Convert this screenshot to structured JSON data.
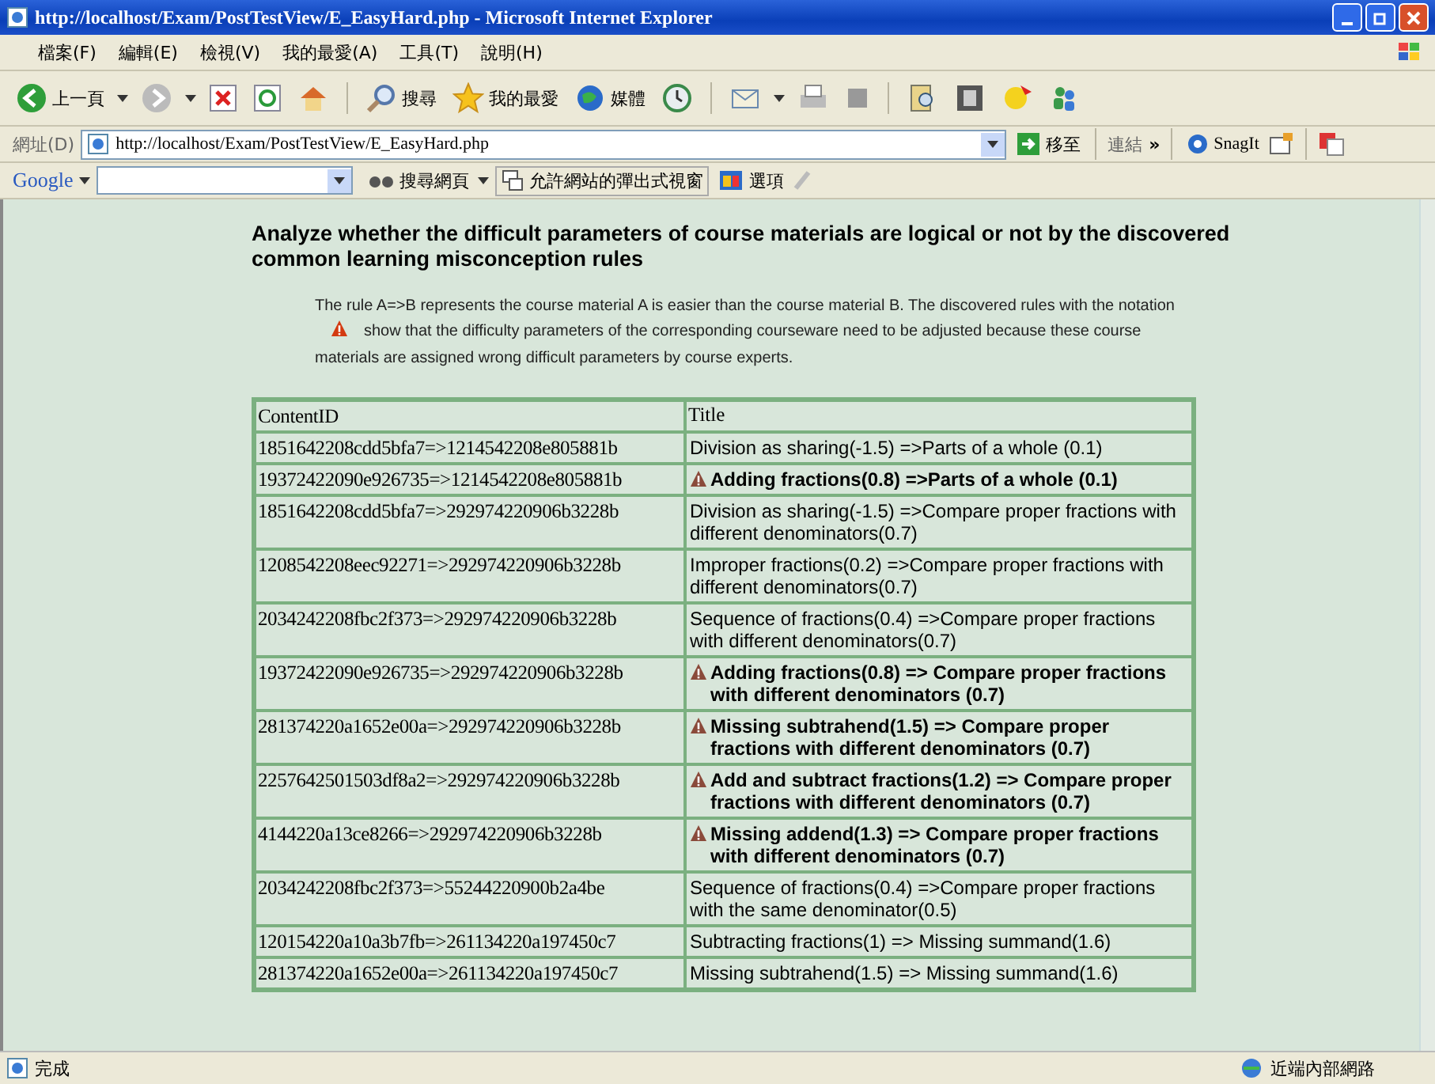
{
  "window": {
    "title": "http://localhost/Exam/PostTestView/E_EasyHard.php - Microsoft Internet Explorer"
  },
  "menu": [
    "檔案(F)",
    "編輯(E)",
    "檢視(V)",
    "我的最愛(A)",
    "工具(T)",
    "說明(H)"
  ],
  "toolbar": {
    "back": "上一頁",
    "search": "搜尋",
    "favorites": "我的最愛",
    "media": "媒體"
  },
  "address_bar": {
    "label": "網址(D)",
    "value": "http://localhost/Exam/PostTestView/E_EasyHard.php",
    "go": "移至",
    "links": "連結",
    "more": "»",
    "snagit": "SnagIt"
  },
  "google_bar": {
    "logo": "Google",
    "search_web": "搜尋網頁",
    "popups": "允許網站的彈出式視窗",
    "options": "選項"
  },
  "heading": "Analyze whether the difficult parameters of course materials are logical or not by the discovered common learning misconception rules",
  "intro_before": "The rule A=>B represents the course material A is easier than the course material B. The discovered rules with the notation",
  "intro_after": "show that the difficulty parameters of the corresponding courseware need to be adjusted because these course materials are assigned wrong difficult parameters by course experts.",
  "table": {
    "columns": [
      "ContentID",
      "Title"
    ],
    "rows": [
      {
        "id": "1851642208cdd5bfa7=>1214542208e805881b",
        "title": "Division as sharing(-1.5) =>Parts of a whole (0.1)",
        "flagged": false
      },
      {
        "id": "19372422090e926735=>1214542208e805881b",
        "title": "Adding fractions(0.8) =>Parts of a whole (0.1)",
        "flagged": true
      },
      {
        "id": "1851642208cdd5bfa7=>292974220906b3228b",
        "title": "Division as sharing(-1.5) =>Compare proper fractions with different denominators(0.7)",
        "flagged": false
      },
      {
        "id": "1208542208eec92271=>292974220906b3228b",
        "title": "Improper fractions(0.2) =>Compare proper fractions with different denominators(0.7)",
        "flagged": false
      },
      {
        "id": "2034242208fbc2f373=>292974220906b3228b",
        "title": "Sequence of fractions(0.4) =>Compare proper fractions with different denominators(0.7)",
        "flagged": false
      },
      {
        "id": "19372422090e926735=>292974220906b3228b",
        "title": "Adding fractions(0.8) => Compare proper fractions with different denominators (0.7)",
        "flagged": true
      },
      {
        "id": "281374220a1652e00a=>292974220906b3228b",
        "title": "Missing subtrahend(1.5) => Compare proper fractions with different denominators (0.7)",
        "flagged": true
      },
      {
        "id": "2257642501503df8a2=>292974220906b3228b",
        "title": "Add and subtract fractions(1.2) => Compare proper fractions with different denominators (0.7)",
        "flagged": true
      },
      {
        "id": "4144220a13ce8266=>292974220906b3228b",
        "title": "Missing addend(1.3) => Compare proper fractions with different denominators (0.7)",
        "flagged": true
      },
      {
        "id": "2034242208fbc2f373=>55244220900b2a4be",
        "title": "Sequence of fractions(0.4) =>Compare proper fractions with the same denominator(0.5)",
        "flagged": false
      },
      {
        "id": "120154220a10a3b7fb=>261134220a197450c7",
        "title": "Subtracting fractions(1) => Missing summand(1.6)",
        "flagged": false
      },
      {
        "id": "281374220a1652e00a=>261134220a197450c7",
        "title": "Missing subtrahend(1.5) => Missing summand(1.6)",
        "flagged": false
      }
    ]
  },
  "status_bar": {
    "status": "完成",
    "zone": "近端內部網路"
  }
}
